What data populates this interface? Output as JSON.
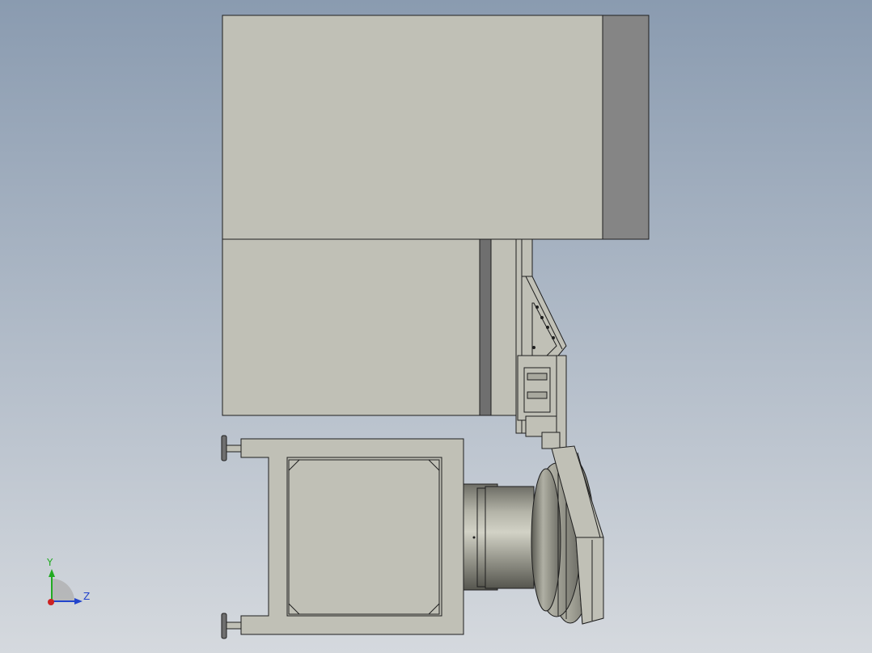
{
  "viewport": {
    "background_top": "#8a9bb0",
    "background_bottom": "#d5d9de"
  },
  "model": {
    "body_color": "#c0c0b6",
    "shadow_color": "#858585",
    "dark_edge_color": "#6f6f6f",
    "outline_color": "#1e1e1e"
  },
  "triad": {
    "y_label": "Y",
    "z_label": "Z",
    "y_color": "#22aa22",
    "z_color": "#2244cc",
    "x_color": "#cc2222"
  }
}
